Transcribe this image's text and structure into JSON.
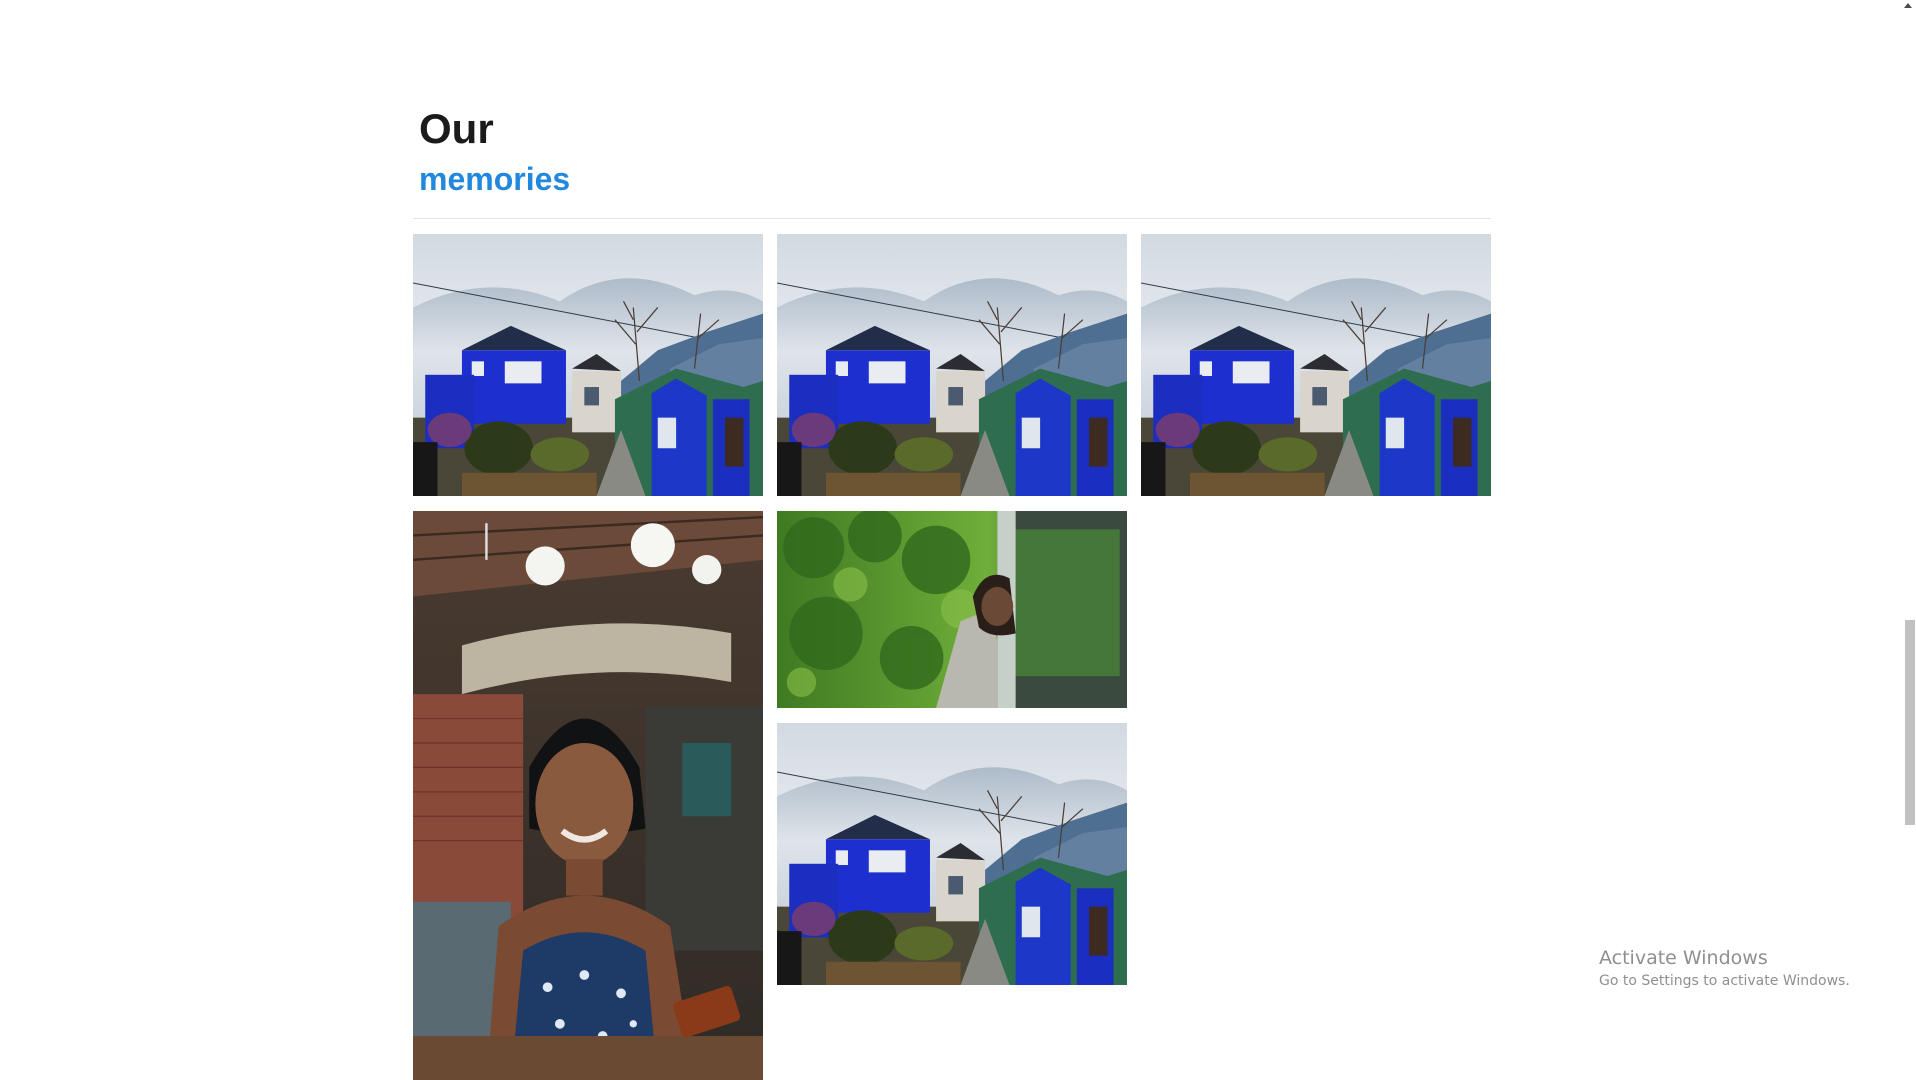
{
  "section": {
    "heading_line1": "Our",
    "heading_line2": "memories"
  },
  "gallery": [
    {
      "scene": "blue-house",
      "name": "gallery-photo-blue-house-1"
    },
    {
      "scene": "blue-house",
      "name": "gallery-photo-blue-house-2"
    },
    {
      "scene": "blue-house",
      "name": "gallery-photo-blue-house-3"
    },
    {
      "scene": "cafe-portrait",
      "name": "gallery-photo-cafe-portrait"
    },
    {
      "scene": "bus-window",
      "name": "gallery-photo-bus-window"
    },
    {
      "scene": "blue-house",
      "name": "gallery-photo-blue-house-4"
    }
  ],
  "os_overlay": {
    "title": "Activate Windows",
    "subtitle": "Go to Settings to activate Windows."
  },
  "colors": {
    "accent": "#2188de",
    "heading": "#1b1b1b",
    "divider": "#e3e3e3"
  }
}
